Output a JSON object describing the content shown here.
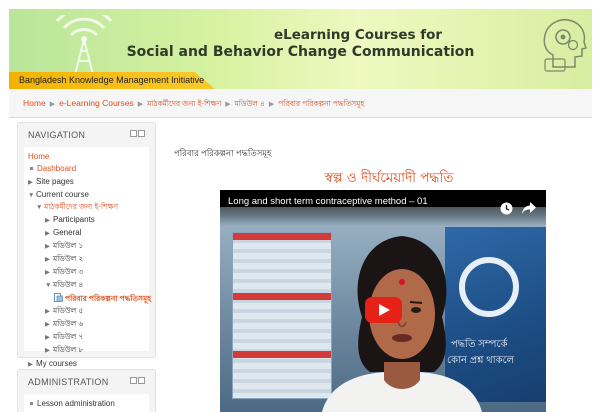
{
  "header": {
    "title_line1": "eLearning Courses for",
    "title_line2": "Social and Behavior Change Communication",
    "tagline": "Bangladesh Knowledge Management Initiative"
  },
  "breadcrumb": [
    "Home",
    "e-Learning Courses",
    "মাঠকর্মীদের জন্য ই-শিক্ষণ",
    "মডিউল ৪",
    "পরিবার পরিকল্পনা পদ্ধতিসমূহ"
  ],
  "navigation": {
    "title": "NAVIGATION",
    "home": "Home",
    "dashboard": "Dashboard",
    "site_pages": "Site pages",
    "current_course": "Current course",
    "course": "মাঠকর্মীদের জন্য ই-শিক্ষণ",
    "participants": "Participants",
    "general": "General",
    "modules": [
      "মডিউল ১",
      "মডিউল ২",
      "মডিউল ৩",
      "মডিউল ৪"
    ],
    "active_lesson": "পরিবার পরিকল্পনা পদ্ধতিসমূহ",
    "modules_after": [
      "মডিউল ৫",
      "মডিউল ৬",
      "মডিউল ৭",
      "মডিউল ৮"
    ],
    "my_courses": "My courses"
  },
  "administration": {
    "title": "ADMINISTRATION",
    "lesson_admin": "Lesson administration"
  },
  "main": {
    "page_heading": "পরিবার পরিকল্পনা পদ্ধতিসমূহ",
    "content_title": "স্বল্প ও দীর্ঘমেয়াদী পদ্ধতি",
    "video_title": "Long and short term contraceptive method – 01",
    "poster_text1": "পদ্ধতি সম্পর্কে",
    "poster_text2": "কোন প্রশ্ন থাকলে"
  },
  "colors": {
    "link": "#e1501f",
    "title_red": "#e24b1c",
    "tagline_band": "#f4b200",
    "youtube_red": "#e62117"
  },
  "icons": [
    "wifi-tower-icon",
    "head-gears-icon",
    "clock-icon",
    "share-icon",
    "play-icon",
    "lesson-icon"
  ]
}
